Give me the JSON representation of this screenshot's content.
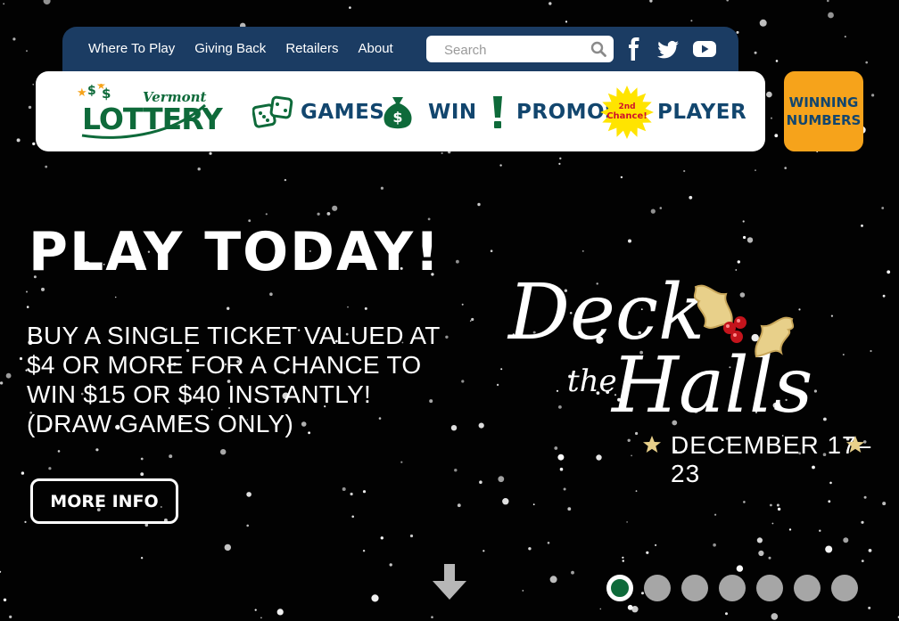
{
  "top_bar": {
    "links": [
      "Where To Play",
      "Giving Back",
      "Retailers",
      "About"
    ],
    "search_placeholder": "Search",
    "social_icons": [
      "facebook-icon",
      "twitter-icon",
      "youtube-icon"
    ]
  },
  "logo": {
    "brand_script": "Vermont",
    "brand_main": "LOTTERY"
  },
  "main_nav": {
    "items": [
      {
        "label": "GAMES",
        "icon": "dice-icon"
      },
      {
        "label": "WIN",
        "icon": "money-bag-icon"
      },
      {
        "label": "PROMOS",
        "icon": "exclamation-icon"
      },
      {
        "label": "PLAYER",
        "icon": "second-chance-burst-icon",
        "badge_line1": "2nd",
        "badge_line2": "Chance!"
      }
    ],
    "winning_numbers": [
      "WINNING",
      "NUMBERS"
    ]
  },
  "hero": {
    "title": "PLAY TODAY!",
    "body": "BUY A SINGLE TICKET VALUED AT $4 OR MORE FOR A CHANCE TO WIN $15 OR $40 INSTANTLY! (DRAW GAMES ONLY)",
    "cta_label": "MORE INFO",
    "promo_word1": "Deck",
    "promo_word2": "the",
    "promo_word3": "Halls",
    "promo_dates": "DECEMBER 17–23"
  },
  "carousel": {
    "slide_count": 7,
    "active_index": 0
  },
  "colors": {
    "nav_blue": "#1b3c63",
    "brand_green": "#0e6a3a",
    "nav_text": "#12466e",
    "accent_orange": "#f6a31b",
    "background": "#020202"
  }
}
